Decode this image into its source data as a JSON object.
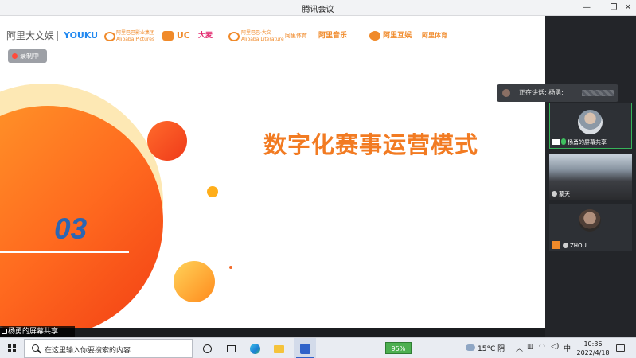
{
  "window": {
    "title": "腾讯会议",
    "controls": [
      "minimize-icon",
      "restore-icon",
      "close-icon"
    ]
  },
  "slide": {
    "title": "数字化赛事运营模式",
    "section_number": "03",
    "logos": [
      "阿里大文娱",
      "YOUKU",
      "阿里巴巴影业集团",
      "UC",
      "大麦",
      "阿里巴巴·大文",
      "阿里体育",
      "阿里音乐",
      "阿里互娱",
      "阿里体育"
    ],
    "logos_small": [
      "Alibaba Pictures",
      "Alibaba Literature"
    ],
    "accent_color": "#f27b22",
    "number_color": "#2b66b3"
  },
  "recording_badge": "录制中",
  "sharer_label": "杨勇的屏幕共享",
  "speaking": {
    "label": "正在讲话: 杨勇;"
  },
  "participants": [
    {
      "name": "杨勇的屏幕共享"
    },
    {
      "name": "蒙天"
    },
    {
      "name": "ZHOU"
    }
  ],
  "taskbar": {
    "search_placeholder": "在这里输入你要搜索的内容",
    "battery": "95%",
    "weather": "15°C  阴",
    "ime": "中",
    "time": "10:36",
    "date": "2022/4/18"
  }
}
